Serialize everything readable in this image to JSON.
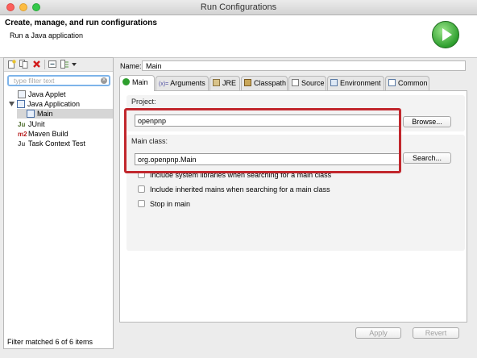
{
  "window": {
    "title": "Run Configurations"
  },
  "banner": {
    "title": "Create, manage, and run configurations",
    "subtitle": "Run a Java application"
  },
  "left": {
    "filter_placeholder": "type filter text",
    "tree": [
      {
        "label": "Java Applet",
        "icon": "java-applet-icon"
      },
      {
        "label": "Java Application",
        "icon": "java-application-icon",
        "expanded": true
      },
      {
        "label": "Main",
        "icon": "launch-config-icon",
        "selected": true
      },
      {
        "label": "JUnit",
        "icon": "junit-icon"
      },
      {
        "label": "Maven Build",
        "icon": "maven-icon",
        "icon_text": "m2"
      },
      {
        "label": "Task Context Test",
        "icon": "task-context-icon"
      }
    ],
    "status": "Filter matched 6 of 6 items"
  },
  "right": {
    "name_label": "Name:",
    "name_value": "Main",
    "tabs": [
      {
        "label": "Main",
        "icon": "main-tab-icon",
        "active": true
      },
      {
        "label": "Arguments",
        "icon": "arguments-icon",
        "icon_text": "(x)="
      },
      {
        "label": "JRE",
        "icon": "jre-icon"
      },
      {
        "label": "Classpath",
        "icon": "classpath-icon"
      },
      {
        "label": "Source",
        "icon": "source-icon"
      },
      {
        "label": "Environment",
        "icon": "environment-icon"
      },
      {
        "label": "Common",
        "icon": "common-icon"
      }
    ],
    "project_label": "Project:",
    "project_value": "openpnp",
    "browse_label": "Browse...",
    "main_class_label": "Main class:",
    "main_class_value": "org.openpnp.Main",
    "search_label": "Search...",
    "checkboxes": [
      {
        "label": "Include system libraries when searching for a main class",
        "checked": false
      },
      {
        "label": "Include inherited mains when searching for a main class",
        "checked": false
      },
      {
        "label": "Stop in main",
        "checked": false
      }
    ],
    "apply_label": "Apply",
    "revert_label": "Revert"
  },
  "colors": {
    "highlight": "#c1272d",
    "run_green": "#2e9f2e",
    "selection": "#d6d6d6"
  }
}
